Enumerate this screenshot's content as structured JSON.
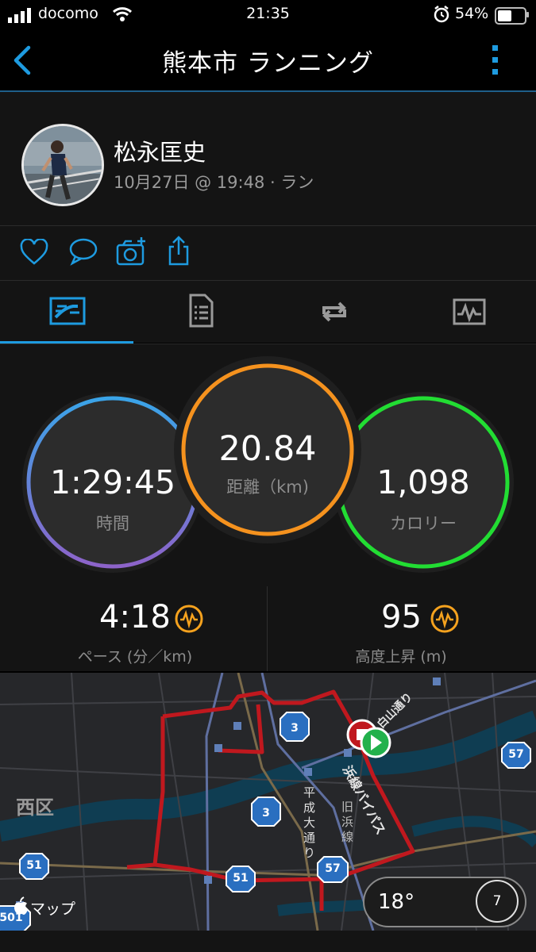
{
  "status_bar": {
    "carrier": "docomo",
    "time": "21:35",
    "battery": "54%",
    "battery_level": 0.54,
    "icons": [
      "signal-icon",
      "wifi-icon",
      "alarm-icon",
      "battery-icon"
    ]
  },
  "nav": {
    "title": "熊本市 ランニング",
    "back_icon": "chevron-left-icon",
    "menu_icon": "more-vertical-icon",
    "accent": "#1e9be0"
  },
  "profile": {
    "name": "松永匡史",
    "meta": "10月27日 @ 19:48 · ラン"
  },
  "actions": [
    "heart-icon",
    "comment-icon",
    "add-photo-icon",
    "share-icon"
  ],
  "tabs": [
    "overview-tab",
    "details-tab",
    "laps-tab",
    "charts-tab"
  ],
  "stats": {
    "time": {
      "value": "1:29:45",
      "label": "時間",
      "color": "#6f8fe8"
    },
    "distance": {
      "value": "20.84",
      "label": "距離（km)",
      "color": "#f5921e"
    },
    "calories": {
      "value": "1,098",
      "label": "カロリー",
      "color": "#22dd33"
    }
  },
  "metrics": {
    "pace": {
      "value": "4:18",
      "label": "ペース (分／km)"
    },
    "elevation": {
      "value": "95",
      "label": "高度上昇 (m)"
    }
  },
  "map": {
    "district": "西区",
    "roads": [
      "平成大通り",
      "旧浜線",
      "浜線バイパス",
      "白山通り"
    ],
    "route_shields": [
      "3",
      "3",
      "51",
      "51",
      "57",
      "57",
      "501"
    ],
    "attribution": "マップ",
    "weather_temp": "18°",
    "compass_value": "7",
    "route_color": "#c0181e"
  }
}
